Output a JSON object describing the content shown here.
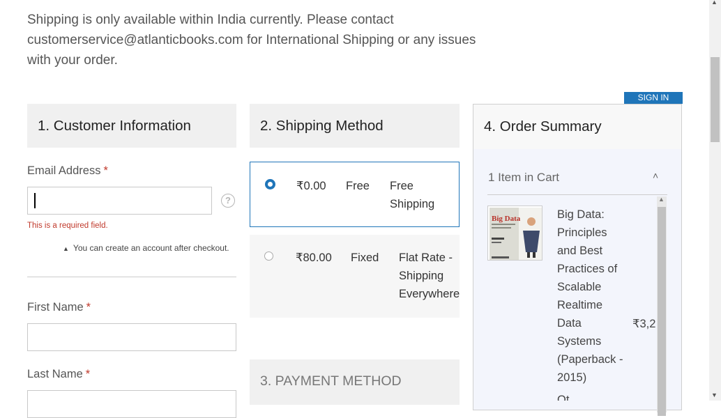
{
  "notice": "Shipping is only available within India currently. Please contact customerservice@atlanticbooks.com for International Shipping or any issues with your order.",
  "signin_label": "SIGN IN",
  "customer": {
    "title": "1. Customer Information",
    "email_label": "Email Address",
    "required_mark": "*",
    "email_value": "",
    "email_error": "This is a required field.",
    "account_hint": "You can create an account after checkout.",
    "help_icon": "?",
    "first_name_label": "First Name",
    "last_name_label": "Last Name"
  },
  "shipping": {
    "title": "2. Shipping Method",
    "options": [
      {
        "price": "₹0.00",
        "method": "Free",
        "carrier": "Free Shipping",
        "selected": true
      },
      {
        "price": "₹80.00",
        "method": "Fixed",
        "carrier": "Flat Rate - Shipping Everywhere",
        "selected": false
      }
    ]
  },
  "payment": {
    "title": "3. PAYMENT METHOD"
  },
  "summary": {
    "title": "4. Order Summary",
    "items_count": "1 Item in Cart",
    "collapse_icon": "chevron-up-icon",
    "product_name": "Big Data: Principles and Best Practices of Scalable Realtime Data Systems (Paperback - 2015)",
    "product_price": "₹3,2",
    "next_line": "Qt",
    "thumb_title": "Big Data"
  },
  "colors": {
    "accent": "#1f75b9",
    "error": "#c0392b"
  }
}
